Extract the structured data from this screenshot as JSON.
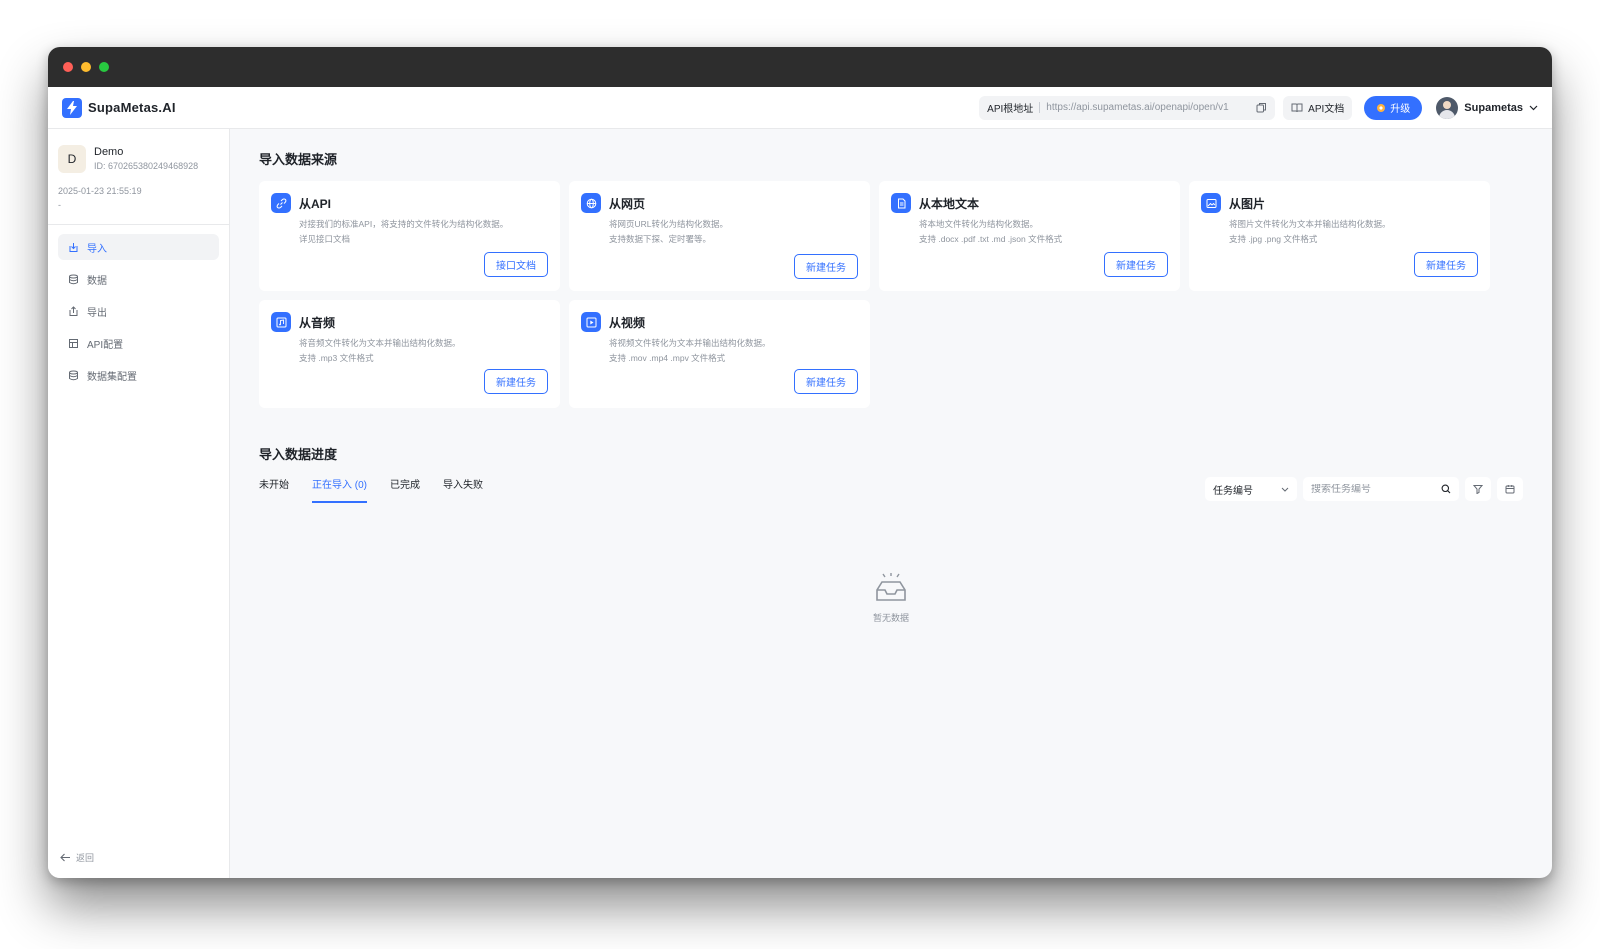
{
  "brand": {
    "name": "SupaMetas.AI",
    "logo_icon": "lightning-icon",
    "accent": "#3370ff"
  },
  "header": {
    "api_base_label": "API根地址",
    "api_base_url": "https://api.supametas.ai/openapi/open/v1",
    "api_doc_label": "API文档",
    "upgrade_label": "升级",
    "user_name": "Supametas"
  },
  "project": {
    "avatar_letter": "D",
    "name": "Demo",
    "id": "ID: 670265380249468928",
    "created": "2025-01-23 21:55:19",
    "note": "-"
  },
  "sidebar": {
    "items": [
      {
        "label": "导入",
        "icon": "import-icon",
        "active": true
      },
      {
        "label": "数据",
        "icon": "database-icon",
        "active": false
      },
      {
        "label": "导出",
        "icon": "export-icon",
        "active": false
      },
      {
        "label": "API配置",
        "icon": "api-config-icon",
        "active": false
      },
      {
        "label": "数据集配置",
        "icon": "dataset-config-icon",
        "active": false
      }
    ],
    "back_label": "返回"
  },
  "sources": {
    "title": "导入数据来源",
    "cards": [
      {
        "title": "从API",
        "icon": "link-icon",
        "desc1": "对接我们的标准API，将支持的文件转化为结构化数据。",
        "desc2": "详见接口文档",
        "button": "接口文档"
      },
      {
        "title": "从网页",
        "icon": "globe-icon",
        "desc1": "将网页URL转化为结构化数据。",
        "desc2": "支持数据下探、定时署等。",
        "button": "新建任务"
      },
      {
        "title": "从本地文本",
        "icon": "document-icon",
        "desc1": "将本地文件转化为结构化数据。",
        "desc2": "支持 .docx .pdf .txt .md .json 文件格式",
        "button": "新建任务"
      },
      {
        "title": "从图片",
        "icon": "image-icon",
        "desc1": "将图片文件转化为文本并输出结构化数据。",
        "desc2": "支持 .jpg .png 文件格式",
        "button": "新建任务"
      },
      {
        "title": "从音频",
        "icon": "audio-icon",
        "desc1": "将音频文件转化为文本并输出结构化数据。",
        "desc2": "支持 .mp3 文件格式",
        "button": "新建任务"
      },
      {
        "title": "从视频",
        "icon": "video-icon",
        "desc1": "将视频文件转化为文本并输出结构化数据。",
        "desc2": "支持 .mov .mp4 .mpv 文件格式",
        "button": "新建任务"
      }
    ]
  },
  "progress": {
    "title": "导入数据进度",
    "tabs": [
      {
        "label": "未开始",
        "active": false
      },
      {
        "label": "正在导入 (0)",
        "active": true
      },
      {
        "label": "已完成",
        "active": false
      },
      {
        "label": "导入失败",
        "active": false
      }
    ],
    "filter_select": "任务编号",
    "search_placeholder": "搜索任务编号",
    "empty_text": "暂无数据"
  }
}
